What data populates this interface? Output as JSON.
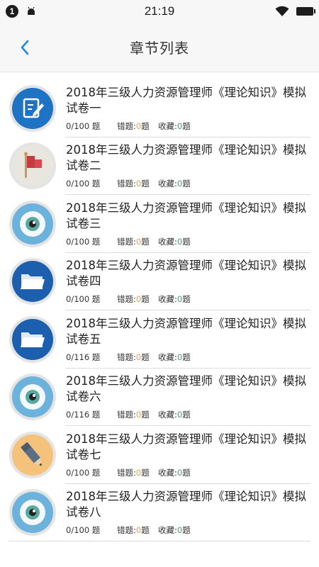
{
  "status_bar": {
    "notification_count": "1",
    "time": "21:19"
  },
  "nav": {
    "title": "章节列表",
    "back_icon": "chevron-left-icon",
    "accent": "#1e88e5"
  },
  "labels": {
    "question_unit": "题",
    "wrong_prefix": "错题:",
    "fav_prefix": "收藏:"
  },
  "chapters": [
    {
      "title": "2018年三级人力资源管理师《理论知识》模拟试卷一",
      "progress": "0/100 题",
      "wrong": "0",
      "fav": "0",
      "icon": "edit-icon"
    },
    {
      "title": "2018年三级人力资源管理师《理论知识》模拟试卷二",
      "progress": "0/100 题",
      "wrong": "0",
      "fav": "0",
      "icon": "flag-icon"
    },
    {
      "title": "2018年三级人力资源管理师《理论知识》模拟试卷三",
      "progress": "0/100 题",
      "wrong": "0",
      "fav": "0",
      "icon": "eye-icon"
    },
    {
      "title": "2018年三级人力资源管理师《理论知识》模拟试卷四",
      "progress": "0/100 题",
      "wrong": "0",
      "fav": "0",
      "icon": "folder-icon"
    },
    {
      "title": "2018年三级人力资源管理师《理论知识》模拟试卷五",
      "progress": "0/116 题",
      "wrong": "0",
      "fav": "0",
      "icon": "folder-icon"
    },
    {
      "title": "2018年三级人力资源管理师《理论知识》模拟试卷六",
      "progress": "0/116 题",
      "wrong": "0",
      "fav": "0",
      "icon": "eye-icon"
    },
    {
      "title": "2018年三级人力资源管理师《理论知识》模拟试卷七",
      "progress": "0/100 题",
      "wrong": "0",
      "fav": "0",
      "icon": "pencil-icon"
    },
    {
      "title": "2018年三级人力资源管理师《理论知识》模拟试卷八",
      "progress": "0/100 题",
      "wrong": "0",
      "fav": "0",
      "icon": "eye-icon"
    }
  ]
}
